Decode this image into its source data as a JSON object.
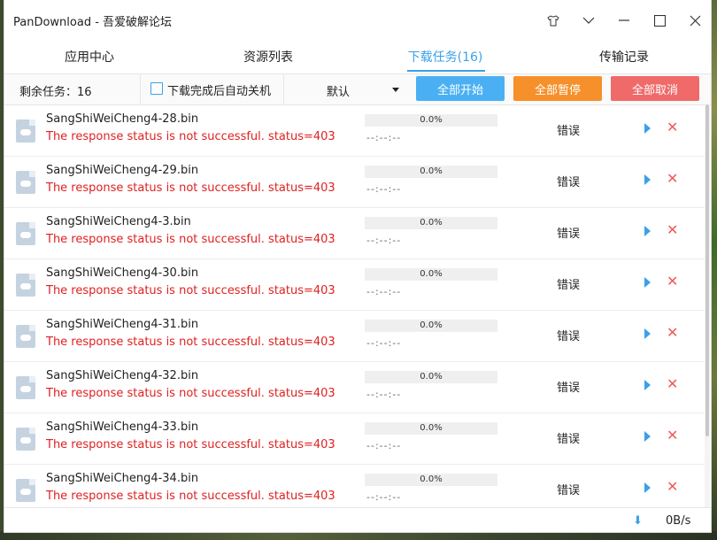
{
  "window": {
    "title": "PanDownload - 吾爱破解论坛"
  },
  "titlebar_icons": [
    "shirt-icon",
    "chevron-down-icon",
    "minimize-icon",
    "maximize-icon",
    "close-icon"
  ],
  "tabs": [
    {
      "label": "应用中心",
      "active": false
    },
    {
      "label": "资源列表",
      "active": false
    },
    {
      "label": "下载任务(16)",
      "active": true
    },
    {
      "label": "传输记录",
      "active": false
    }
  ],
  "toolbar": {
    "remaining": "剩余任务：16",
    "autoshutdown_label": "下载完成后自动关机",
    "autoshutdown_checked": false,
    "sort_value": "默认",
    "start_all": "全部开始",
    "pause_all": "全部暂停",
    "cancel_all": "全部取消"
  },
  "tasks": [
    {
      "name": "SangShiWeiCheng4-28.bin",
      "error": "The response status is not successful. status=403",
      "progress": "0.0%",
      "eta": "--:--:--",
      "status": "错误"
    },
    {
      "name": "SangShiWeiCheng4-29.bin",
      "error": "The response status is not successful. status=403",
      "progress": "0.0%",
      "eta": "--:--:--",
      "status": "错误"
    },
    {
      "name": "SangShiWeiCheng4-3.bin",
      "error": "The response status is not successful. status=403",
      "progress": "0.0%",
      "eta": "--:--:--",
      "status": "错误"
    },
    {
      "name": "SangShiWeiCheng4-30.bin",
      "error": "The response status is not successful. status=403",
      "progress": "0.0%",
      "eta": "--:--:--",
      "status": "错误"
    },
    {
      "name": "SangShiWeiCheng4-31.bin",
      "error": "The response status is not successful. status=403",
      "progress": "0.0%",
      "eta": "--:--:--",
      "status": "错误"
    },
    {
      "name": "SangShiWeiCheng4-32.bin",
      "error": "The response status is not successful. status=403",
      "progress": "0.0%",
      "eta": "--:--:--",
      "status": "错误"
    },
    {
      "name": "SangShiWeiCheng4-33.bin",
      "error": "The response status is not successful. status=403",
      "progress": "0.0%",
      "eta": "--:--:--",
      "status": "错误"
    },
    {
      "name": "SangShiWeiCheng4-34.bin",
      "error": "The response status is not successful. status=403",
      "progress": "0.0%",
      "eta": "--:--:--",
      "status": "错误"
    }
  ],
  "statusbar": {
    "speed": "0B/s"
  },
  "colors": {
    "accent": "#3aa0e8",
    "error": "#e02020",
    "start": "#4ab0f3",
    "pause": "#f5902a",
    "cancel": "#f06a6a"
  }
}
